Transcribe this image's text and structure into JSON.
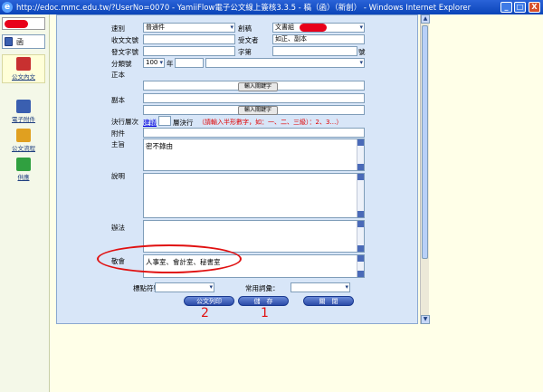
{
  "window": {
    "title": "http://edoc.mmc.edu.tw/?UserNo=0070 - YamiiFlow電子公文線上簽核3.3.5 - 稿（函）（新創） - Windows Internet Explorer",
    "minimize": "_",
    "maximize": "□",
    "close": "X"
  },
  "sidebar": {
    "title_tab": "函",
    "items": [
      {
        "label": "公文內文",
        "icon": "document-edit-icon",
        "color": "#c83030"
      },
      {
        "label": "電子附件",
        "icon": "attachment-icon",
        "color": "#3a5fb0"
      },
      {
        "label": "公文流程",
        "icon": "flow-icon",
        "color": "#e0a020"
      },
      {
        "label": "供應",
        "icon": "supply-icon",
        "color": "#30a040"
      }
    ]
  },
  "form": {
    "type_label": "速別",
    "type_value": "普通件",
    "draft_label": "創稿",
    "draft_value": "文書組",
    "receive_no_label": "收文文號",
    "recipient_label": "受文者",
    "recipient_value": "如正、副本",
    "send_no_label": "發文字號",
    "word_label": "字第",
    "hao_label": "號",
    "class_label": "分類號",
    "class_value": "100",
    "year_label": "年",
    "main_copy_label": "正本",
    "input_key_btn": "輸入關鍵字",
    "cc_label": "副本",
    "exec_label": "決行層次",
    "suggest_link": "建議",
    "level_suffix": "層決行",
    "level_hint": "（請輸入半形數字，如：一、二、三級）：2、3…）",
    "attach_label": "附件",
    "subject_label": "主旨",
    "subject_value": "密不錄由",
    "desc_label": "說明",
    "method_label": "辦法",
    "countersign_label": "敬會",
    "countersign_value": "人事室、會計室、秘書室",
    "stamp_label": "標點符號：",
    "common_label": "常用詞彙：",
    "print_btn": "公文列印",
    "save_btn": "儲　存",
    "close_btn": "關　閉"
  },
  "annotations": {
    "one": "1",
    "two": "2",
    "color": "#e01010"
  }
}
